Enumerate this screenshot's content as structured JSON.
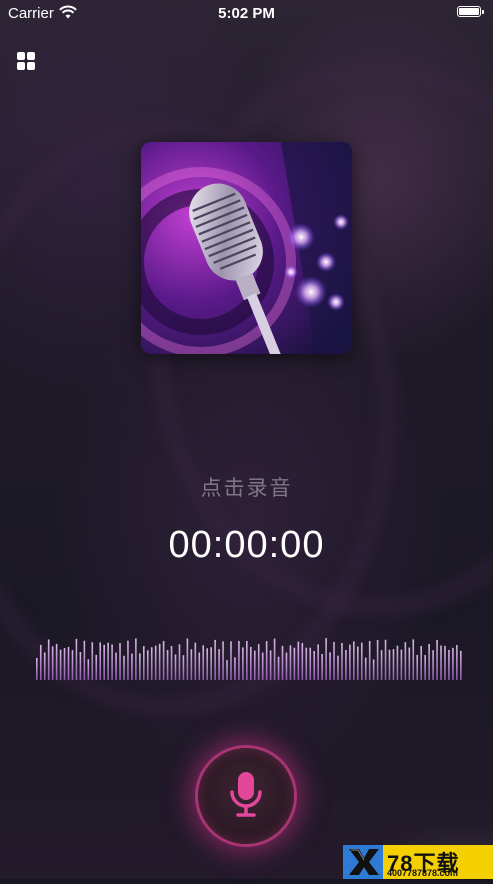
{
  "status_bar": {
    "carrier": "Carrier",
    "time": "5:02 PM"
  },
  "header": {
    "menu_icon": "grid-icon"
  },
  "cover": {
    "image": "microphone-artwork"
  },
  "recorder": {
    "hint": "点击录音",
    "timer": "00:00:00",
    "record_icon": "microphone-icon",
    "accent_color": "#e2479a"
  },
  "watermark": {
    "brand": "78下载",
    "phone": "4007787878.com"
  }
}
